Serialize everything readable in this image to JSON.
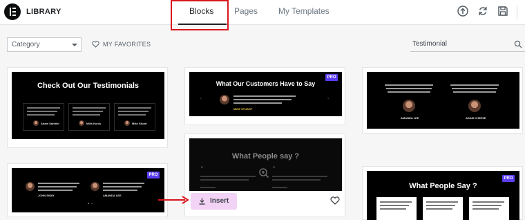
{
  "header": {
    "brand": "LIBRARY",
    "tabs": [
      {
        "label": "Blocks",
        "active": true
      },
      {
        "label": "Pages",
        "active": false
      },
      {
        "label": "My Templates",
        "active": false
      }
    ],
    "icons": [
      "upload-icon",
      "sync-icon",
      "save-icon"
    ]
  },
  "toolbar": {
    "category_value": "Category",
    "favorites_label": "MY FAVORITES",
    "search_value": "Testimonial"
  },
  "cards": {
    "c1": {
      "title": "Check Out Our Testimonials",
      "names": [
        "Adam Sandler",
        "Mills Kunis",
        "Mike Stuart"
      ]
    },
    "c2": {
      "title": "What Our Customers Have to Say",
      "badge": "PRO",
      "name": "MIKE STUART"
    },
    "c3": {
      "names": [
        "AMANDA LEE",
        "ADAM CHEESE"
      ]
    },
    "c4": {
      "badge": "PRO",
      "names": [
        "JOHN SWAY",
        "AMANDA LEE"
      ]
    },
    "c5": {
      "title": "What People say ?",
      "insert_label": "Insert"
    },
    "c6": {
      "title": "What People Say ?",
      "badge": "PRO"
    }
  },
  "colors": {
    "accent_pro": "#5b3cf0",
    "insert_bg": "#f2d2f5",
    "highlight": "#d9141c",
    "arrow": "#d9141c"
  }
}
